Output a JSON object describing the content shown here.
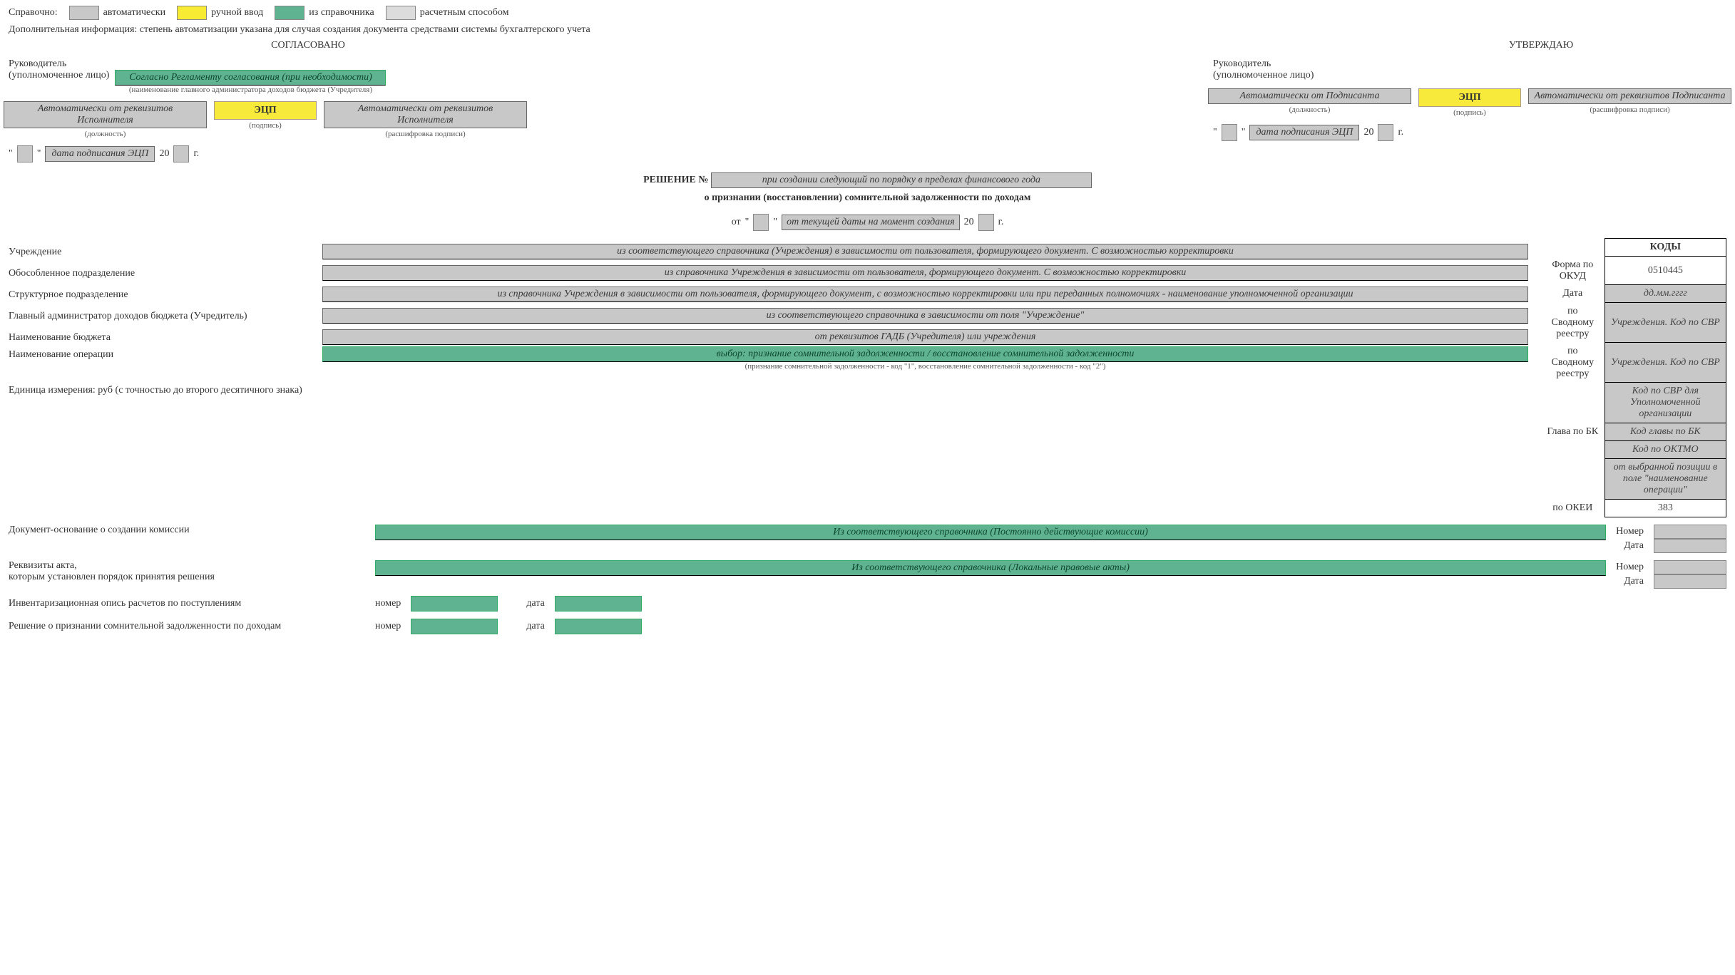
{
  "legend": {
    "prefix": "Справочно:",
    "auto": "автоматически",
    "manual": "ручной ввод",
    "ref": "из справочника",
    "calc": "расчетным способом"
  },
  "addl": "Дополнительная информация: степень автоматизации указана для случая создания документа средствами системы бухгалтерского учета",
  "approve": {
    "left_head": "СОГЛАСОВАНО",
    "right_head": "УТВЕРЖДАЮ",
    "leader": "Руководитель",
    "authorized": "(уполномоченное лицо)",
    "reglament": "Согласно Регламенту согласования (при необходимости)",
    "reglament_note": "(наименование главного администратора доходов бюджета (Учредителя)",
    "auto_ispol": "Автоматически от реквизитов Исполнителя",
    "auto_podpisant": "Автоматически от Подписанта",
    "auto_podpisant_rek": "Автоматически от реквизитов Подписанта",
    "ecp": "ЭЦП",
    "dolzh": "(должность)",
    "podpis": "(подпись)",
    "rasshifr": "(расшифровка подписи)",
    "sign_date": "дата подписания ЭЦП",
    "y20": "20",
    "g": "г."
  },
  "title": {
    "dec_no": "РЕШЕНИЕ №",
    "dec_num_val": "при создании следующий по порядку в пределах финансового года",
    "subtitle": "о признании (восстановлении) сомнительной задолженности по доходам",
    "from": "от",
    "from_val": "от текущей даты на момент создания"
  },
  "codes": {
    "header": "КОДЫ",
    "rows": [
      {
        "label": "Форма по ОКУД",
        "val": "0510445",
        "white": true
      },
      {
        "label": "Дата",
        "val": "дд.мм.гггг"
      },
      {
        "label": "по Сводному реестру",
        "val": "Учреждения. Код по СВР"
      },
      {
        "label": "по Сводному реестру",
        "val": "Учреждения. Код по СВР"
      },
      {
        "label": "",
        "val": "Код по СВР для Уполномоченной организации"
      },
      {
        "label": "Глава по БК",
        "val": "Код главы по БК"
      },
      {
        "label": "",
        "val": "Код по ОКТМО"
      },
      {
        "label": "",
        "val": "от выбранной позиции в поле \"наименование операции\""
      },
      {
        "label": "по ОКЕИ",
        "val": "383",
        "white": true
      }
    ]
  },
  "fields": {
    "uchr_l": "Учреждение",
    "uchr_v": "из соответствующего справочника (Учреждения) в зависимости от пользователя, формирующего документ. С возможностью корректировки",
    "obos_l": "Обособленное подразделение",
    "obos_v": "из справочника Учреждения в зависимости от пользователя, формирующего документ. С возможностью корректировки",
    "struct_l": "Структурное подразделение",
    "struct_v": "из справочника Учреждения в зависимости от пользователя, формирующего документ, с возможностью корректировки или при переданных полномочиях - наименование уполномоченной организации",
    "gadb_l": "Главный администратор доходов бюджета (Учредитель)",
    "gadb_v": "из соответствующего справочника в зависимости от поля \"Учреждение\"",
    "budg_l": "Наименование бюджета",
    "budg_v": "от реквизитов ГАДБ (Учредителя) или учреждения",
    "oper_l": "Наименование операции",
    "oper_v": "выбор: признание сомнительной задолженности / восстановление сомнительной задолженности",
    "oper_note": "(признание сомнительной задолженности - код \"1\", восстановление сомнительной задолженности - код \"2\")",
    "unit": "Единица измерения: руб (с точностью до второго десятичного знака)"
  },
  "refs": {
    "doc_base_l": "Документ-основание о создании комиссии",
    "doc_base_v": "Из соответствующего справочника (Постоянно действующие комиссии)",
    "akta_l1": "Реквизиты акта,",
    "akta_l2": "которым установлен порядок принятия решения",
    "akta_v": "Из соответствующего справочника (Локальные правовые акты)",
    "number": "Номер",
    "date": "Дата",
    "inv_l": "Инвентаризационная опись расчетов по поступлениям",
    "resh_l": "Решение о признании сомнительной задолженности по доходам",
    "nomer": "номер",
    "data": "дата"
  }
}
